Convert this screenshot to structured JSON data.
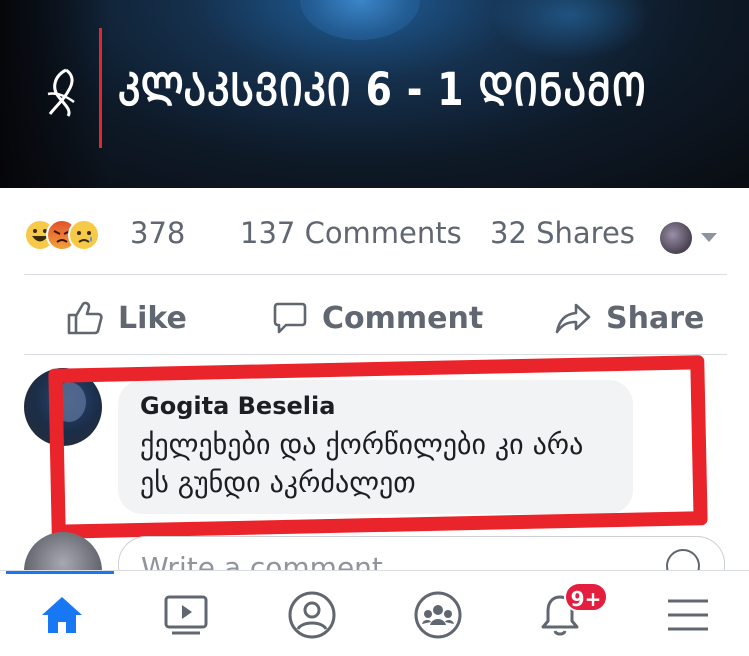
{
  "post": {
    "headline": "ᲙᲚᲐᲙᲡᲕᲘᲙᲘ 6 - 1 ᲓᲘᲜᲐᲛᲝ",
    "reactions_count": "378",
    "comments_count": "137 Comments",
    "shares_count": "32 Shares",
    "reaction_icons": [
      "haha-icon",
      "angry-icon",
      "sad-icon"
    ]
  },
  "actions": {
    "like_label": "Like",
    "comment_label": "Comment",
    "share_label": "Share"
  },
  "comment": {
    "author": "Gogita Beselia",
    "text": "ქელეხები და ქორწილები კი არა ეს გუნდი აკრძალეთ"
  },
  "composer": {
    "placeholder": "Write a comment..."
  },
  "bottom_nav": {
    "notifications_badge": "9+",
    "items": [
      "home-icon",
      "watch-icon",
      "profile-icon",
      "groups-icon",
      "notifications-icon",
      "menu-icon"
    ]
  },
  "colors": {
    "highlight": "#e9242a",
    "accent": "#1877f2",
    "badge": "#e41e3f"
  }
}
